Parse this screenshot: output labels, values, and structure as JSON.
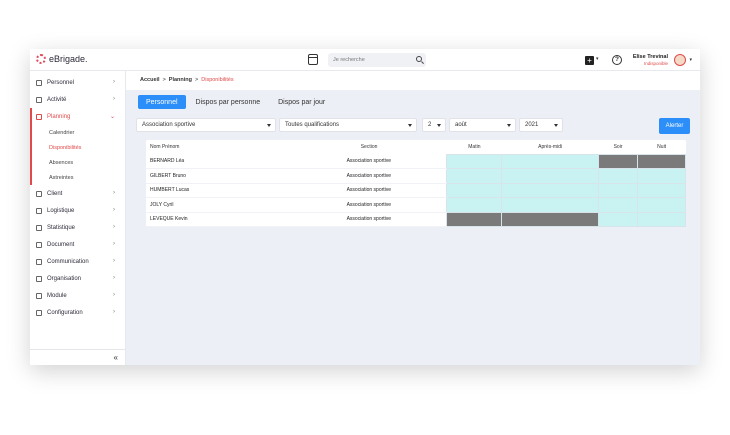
{
  "app": {
    "logo_text": "eBrigade."
  },
  "topbar": {
    "search_placeholder": "Je recherche",
    "user_name": "Elise Trevinal",
    "user_status": "Indisponible"
  },
  "sidebar": {
    "items": [
      {
        "label": "Personnel",
        "icon": "person-icon"
      },
      {
        "label": "Activité",
        "icon": "calendar-icon"
      },
      {
        "label": "Planning",
        "icon": "planning-icon",
        "active": true
      },
      {
        "label": "Client",
        "icon": "client-icon"
      },
      {
        "label": "Logistique",
        "icon": "logistics-icon"
      },
      {
        "label": "Statistique",
        "icon": "stats-icon"
      },
      {
        "label": "Document",
        "icon": "document-icon"
      },
      {
        "label": "Communication",
        "icon": "mail-icon"
      },
      {
        "label": "Organisation",
        "icon": "org-icon"
      },
      {
        "label": "Module",
        "icon": "module-icon"
      },
      {
        "label": "Configuration",
        "icon": "gear-icon"
      }
    ],
    "sub_items": [
      "Calendrier",
      "Disponibilités",
      "Absences",
      "Astreintes"
    ],
    "collapse_glyph": "«"
  },
  "breadcrumb": {
    "home": "Accueil",
    "section": "Planning",
    "current": "Disponibilités",
    "sep": ">"
  },
  "tabs": [
    "Personnel",
    "Dispos par personne",
    "Dispos par jour"
  ],
  "filters": {
    "association": "Association sportive",
    "qualification": "Toutes qualifications",
    "number": "2",
    "month": "août",
    "year": "2021",
    "alert_label": "Alerter"
  },
  "table": {
    "headers": [
      "Nom Prénom",
      "Section",
      "Matin",
      "Après-midi",
      "Soir",
      "Nuit"
    ],
    "rows": [
      {
        "name": "BERNARD Léa",
        "section": "Association sportive",
        "slots": [
          "avail",
          "avail",
          "unavail",
          "unavail"
        ]
      },
      {
        "name": "GILBERT Bruno",
        "section": "Association sportive",
        "slots": [
          "avail",
          "avail",
          "avail",
          "avail"
        ]
      },
      {
        "name": "HUMBERT Lucas",
        "section": "Association sportive",
        "slots": [
          "avail",
          "avail",
          "avail",
          "avail"
        ]
      },
      {
        "name": "JOLY Cyril",
        "section": "Association sportive",
        "slots": [
          "avail",
          "avail",
          "avail",
          "avail"
        ]
      },
      {
        "name": "LEVEQUE Kevin",
        "section": "Association sportive",
        "slots": [
          "unavail",
          "unavail",
          "avail",
          "avail"
        ]
      }
    ]
  },
  "colors": {
    "accent": "#e04a4a",
    "primary": "#2c8ef8",
    "available": "#c9f3f2",
    "unavailable": "#7a7a7a"
  }
}
